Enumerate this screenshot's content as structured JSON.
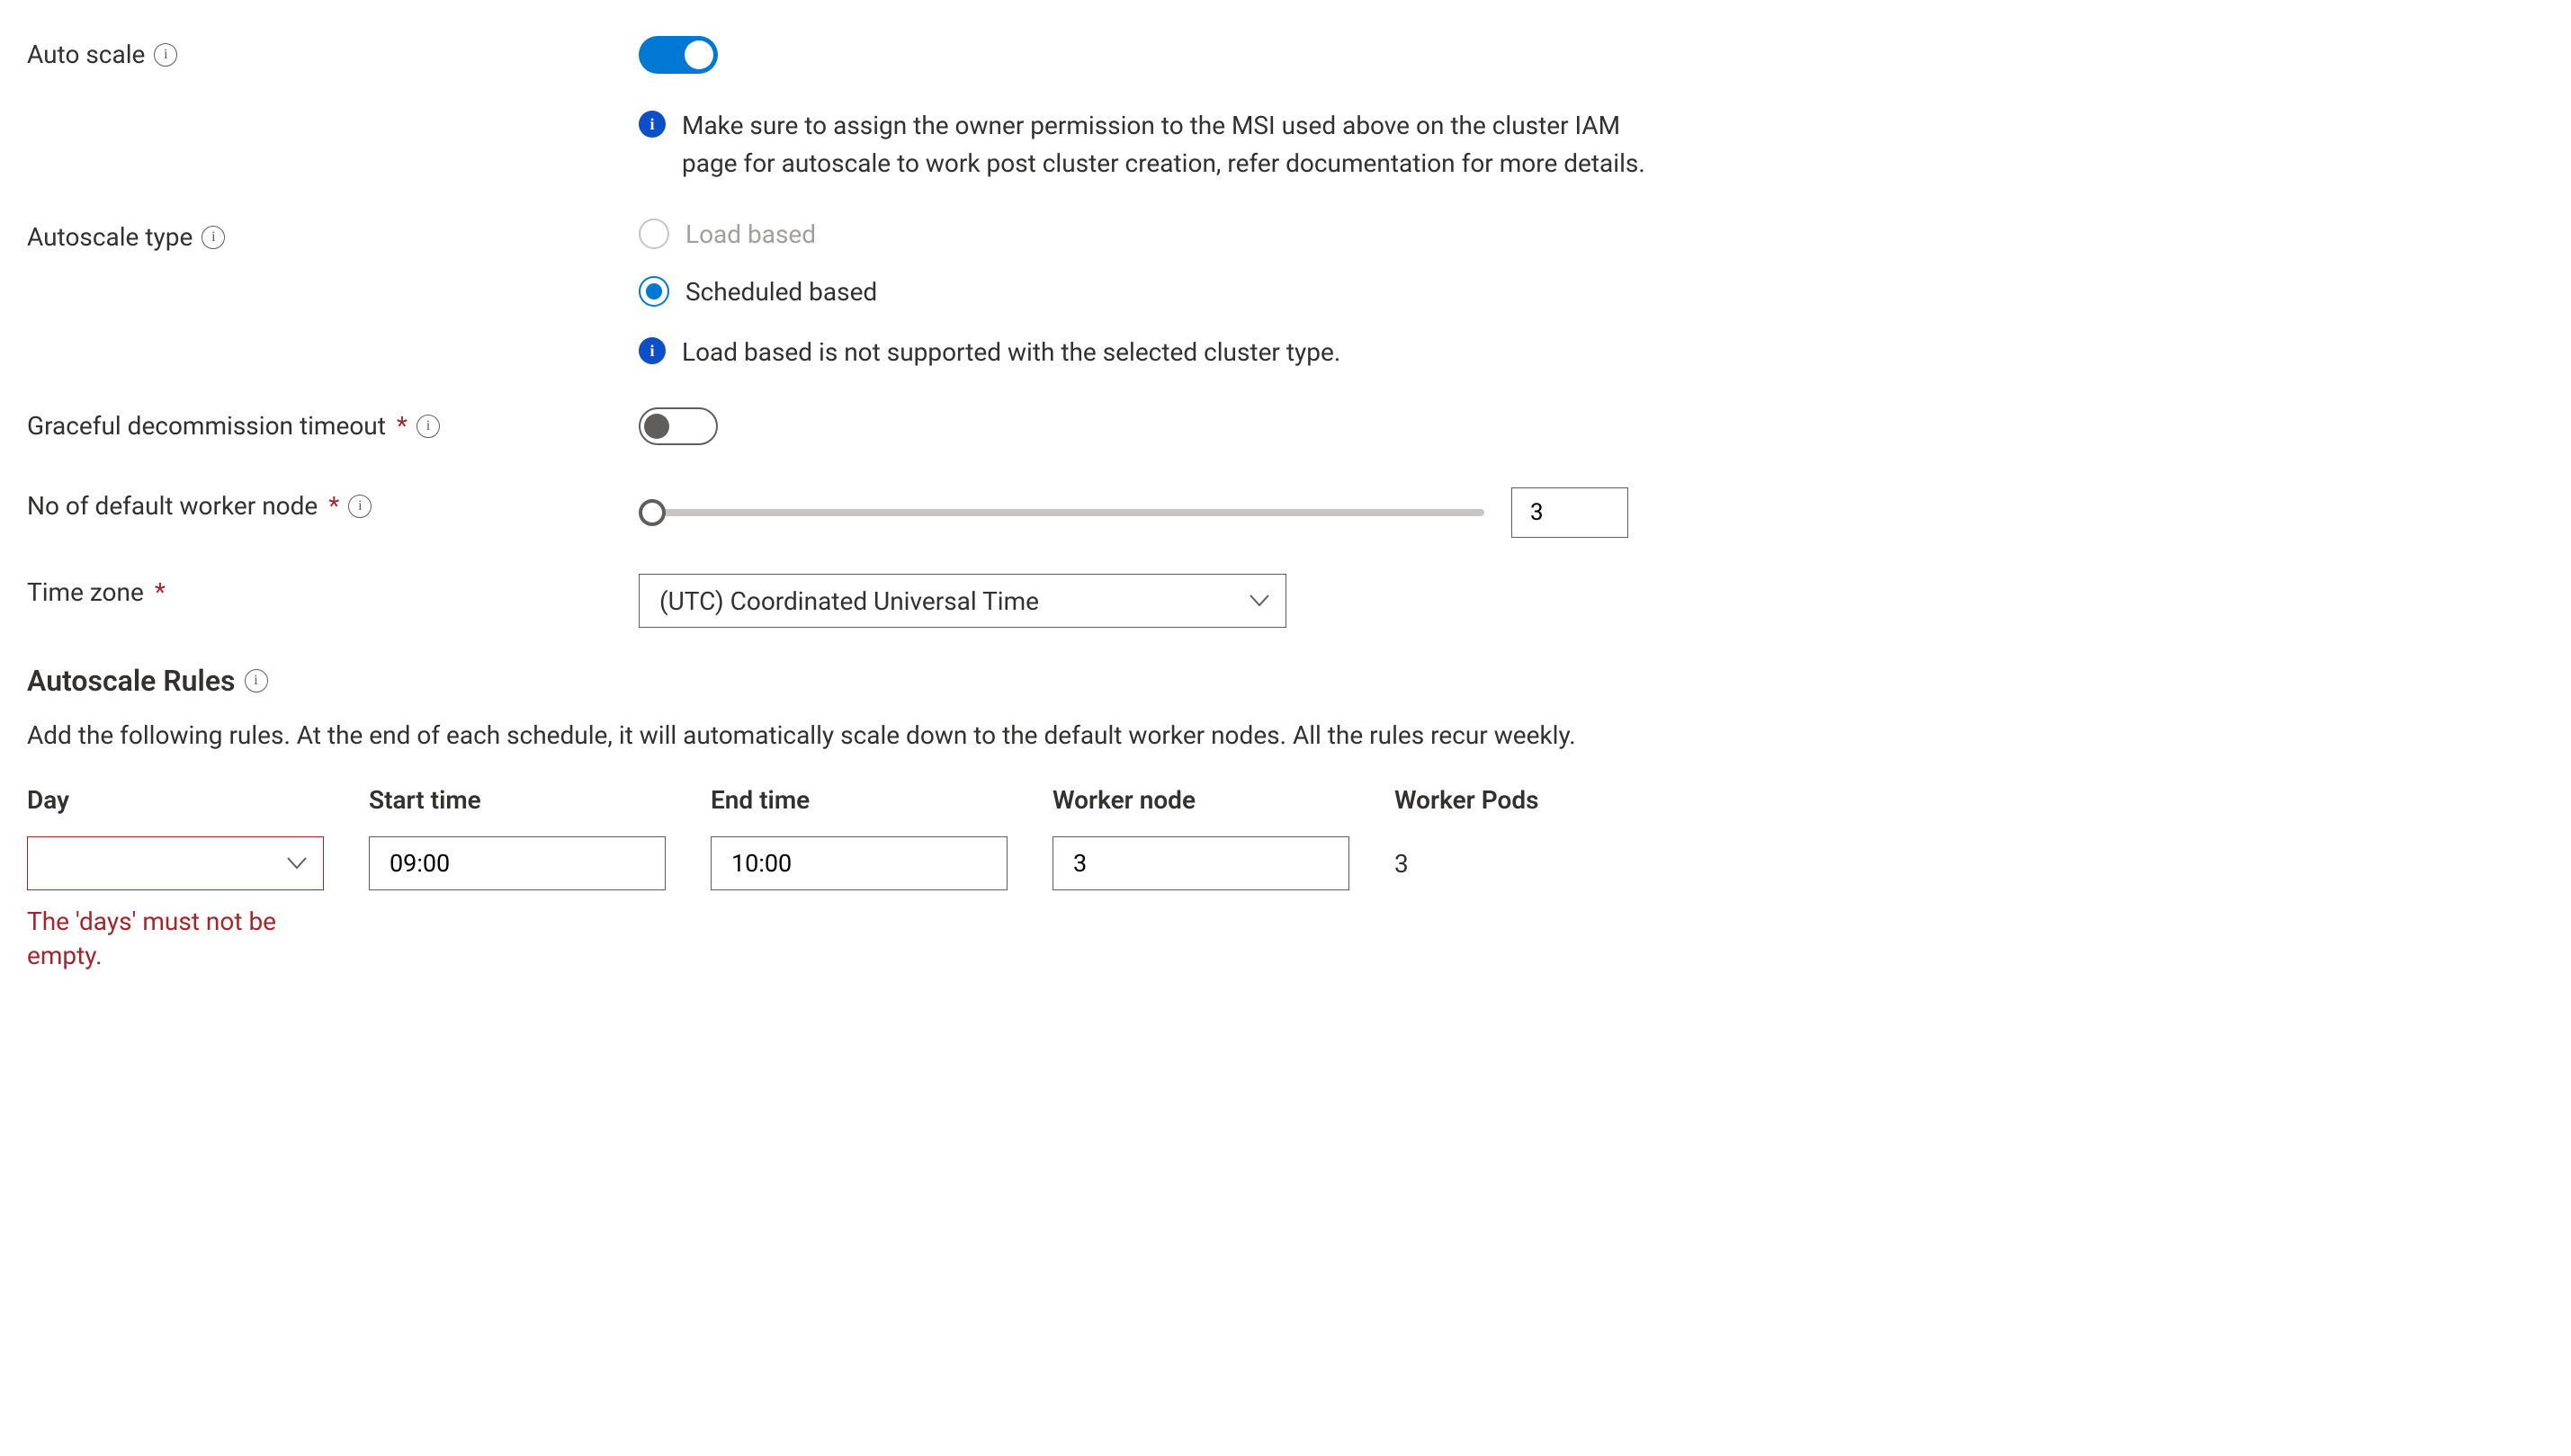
{
  "autoScale": {
    "label": "Auto scale",
    "enabled": true,
    "infoMessage": "Make sure to assign the owner permission to the MSI used above on the cluster IAM page for autoscale to work post cluster creation, refer documentation for more details."
  },
  "autoscaleType": {
    "label": "Autoscale type",
    "options": {
      "loadBased": "Load based",
      "scheduledBased": "Scheduled based"
    },
    "selected": "scheduledBased",
    "disabled": "loadBased",
    "warning": "Load based is not supported with the selected cluster type."
  },
  "gracefulDecommission": {
    "label": "Graceful decommission timeout",
    "enabled": false
  },
  "defaultWorkerNode": {
    "label": "No of default worker node",
    "value": "3"
  },
  "timeZone": {
    "label": "Time zone",
    "value": "(UTC) Coordinated Universal Time"
  },
  "rulesSection": {
    "title": "Autoscale Rules",
    "description": "Add the following rules. At the end of each schedule, it will automatically scale down to the default worker nodes. All the rules recur weekly."
  },
  "rulesTable": {
    "headers": {
      "day": "Day",
      "startTime": "Start time",
      "endTime": "End time",
      "workerNode": "Worker node",
      "workerPods": "Worker Pods"
    },
    "rows": [
      {
        "day": "",
        "startTime": "09:00",
        "endTime": "10:00",
        "workerNode": "3",
        "workerPods": "3",
        "dayError": "The 'days' must not be empty."
      }
    ]
  }
}
